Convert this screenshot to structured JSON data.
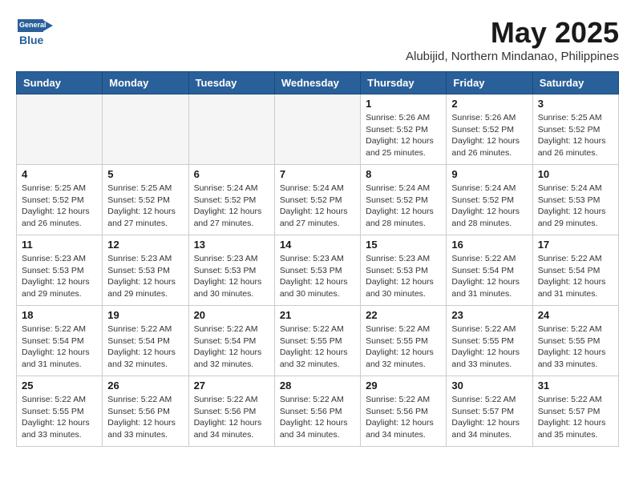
{
  "header": {
    "logo_line1": "General",
    "logo_line2": "Blue",
    "main_title": "May 2025",
    "subtitle": "Alubijid, Northern Mindanao, Philippines"
  },
  "days_of_week": [
    "Sunday",
    "Monday",
    "Tuesday",
    "Wednesday",
    "Thursday",
    "Friday",
    "Saturday"
  ],
  "weeks": [
    [
      {
        "day": "",
        "info": ""
      },
      {
        "day": "",
        "info": ""
      },
      {
        "day": "",
        "info": ""
      },
      {
        "day": "",
        "info": ""
      },
      {
        "day": "1",
        "info": "Sunrise: 5:26 AM\nSunset: 5:52 PM\nDaylight: 12 hours\nand 25 minutes."
      },
      {
        "day": "2",
        "info": "Sunrise: 5:26 AM\nSunset: 5:52 PM\nDaylight: 12 hours\nand 26 minutes."
      },
      {
        "day": "3",
        "info": "Sunrise: 5:25 AM\nSunset: 5:52 PM\nDaylight: 12 hours\nand 26 minutes."
      }
    ],
    [
      {
        "day": "4",
        "info": "Sunrise: 5:25 AM\nSunset: 5:52 PM\nDaylight: 12 hours\nand 26 minutes."
      },
      {
        "day": "5",
        "info": "Sunrise: 5:25 AM\nSunset: 5:52 PM\nDaylight: 12 hours\nand 27 minutes."
      },
      {
        "day": "6",
        "info": "Sunrise: 5:24 AM\nSunset: 5:52 PM\nDaylight: 12 hours\nand 27 minutes."
      },
      {
        "day": "7",
        "info": "Sunrise: 5:24 AM\nSunset: 5:52 PM\nDaylight: 12 hours\nand 27 minutes."
      },
      {
        "day": "8",
        "info": "Sunrise: 5:24 AM\nSunset: 5:52 PM\nDaylight: 12 hours\nand 28 minutes."
      },
      {
        "day": "9",
        "info": "Sunrise: 5:24 AM\nSunset: 5:52 PM\nDaylight: 12 hours\nand 28 minutes."
      },
      {
        "day": "10",
        "info": "Sunrise: 5:24 AM\nSunset: 5:53 PM\nDaylight: 12 hours\nand 29 minutes."
      }
    ],
    [
      {
        "day": "11",
        "info": "Sunrise: 5:23 AM\nSunset: 5:53 PM\nDaylight: 12 hours\nand 29 minutes."
      },
      {
        "day": "12",
        "info": "Sunrise: 5:23 AM\nSunset: 5:53 PM\nDaylight: 12 hours\nand 29 minutes."
      },
      {
        "day": "13",
        "info": "Sunrise: 5:23 AM\nSunset: 5:53 PM\nDaylight: 12 hours\nand 30 minutes."
      },
      {
        "day": "14",
        "info": "Sunrise: 5:23 AM\nSunset: 5:53 PM\nDaylight: 12 hours\nand 30 minutes."
      },
      {
        "day": "15",
        "info": "Sunrise: 5:23 AM\nSunset: 5:53 PM\nDaylight: 12 hours\nand 30 minutes."
      },
      {
        "day": "16",
        "info": "Sunrise: 5:22 AM\nSunset: 5:54 PM\nDaylight: 12 hours\nand 31 minutes."
      },
      {
        "day": "17",
        "info": "Sunrise: 5:22 AM\nSunset: 5:54 PM\nDaylight: 12 hours\nand 31 minutes."
      }
    ],
    [
      {
        "day": "18",
        "info": "Sunrise: 5:22 AM\nSunset: 5:54 PM\nDaylight: 12 hours\nand 31 minutes."
      },
      {
        "day": "19",
        "info": "Sunrise: 5:22 AM\nSunset: 5:54 PM\nDaylight: 12 hours\nand 32 minutes."
      },
      {
        "day": "20",
        "info": "Sunrise: 5:22 AM\nSunset: 5:54 PM\nDaylight: 12 hours\nand 32 minutes."
      },
      {
        "day": "21",
        "info": "Sunrise: 5:22 AM\nSunset: 5:55 PM\nDaylight: 12 hours\nand 32 minutes."
      },
      {
        "day": "22",
        "info": "Sunrise: 5:22 AM\nSunset: 5:55 PM\nDaylight: 12 hours\nand 32 minutes."
      },
      {
        "day": "23",
        "info": "Sunrise: 5:22 AM\nSunset: 5:55 PM\nDaylight: 12 hours\nand 33 minutes."
      },
      {
        "day": "24",
        "info": "Sunrise: 5:22 AM\nSunset: 5:55 PM\nDaylight: 12 hours\nand 33 minutes."
      }
    ],
    [
      {
        "day": "25",
        "info": "Sunrise: 5:22 AM\nSunset: 5:55 PM\nDaylight: 12 hours\nand 33 minutes."
      },
      {
        "day": "26",
        "info": "Sunrise: 5:22 AM\nSunset: 5:56 PM\nDaylight: 12 hours\nand 33 minutes."
      },
      {
        "day": "27",
        "info": "Sunrise: 5:22 AM\nSunset: 5:56 PM\nDaylight: 12 hours\nand 34 minutes."
      },
      {
        "day": "28",
        "info": "Sunrise: 5:22 AM\nSunset: 5:56 PM\nDaylight: 12 hours\nand 34 minutes."
      },
      {
        "day": "29",
        "info": "Sunrise: 5:22 AM\nSunset: 5:56 PM\nDaylight: 12 hours\nand 34 minutes."
      },
      {
        "day": "30",
        "info": "Sunrise: 5:22 AM\nSunset: 5:57 PM\nDaylight: 12 hours\nand 34 minutes."
      },
      {
        "day": "31",
        "info": "Sunrise: 5:22 AM\nSunset: 5:57 PM\nDaylight: 12 hours\nand 35 minutes."
      }
    ]
  ]
}
